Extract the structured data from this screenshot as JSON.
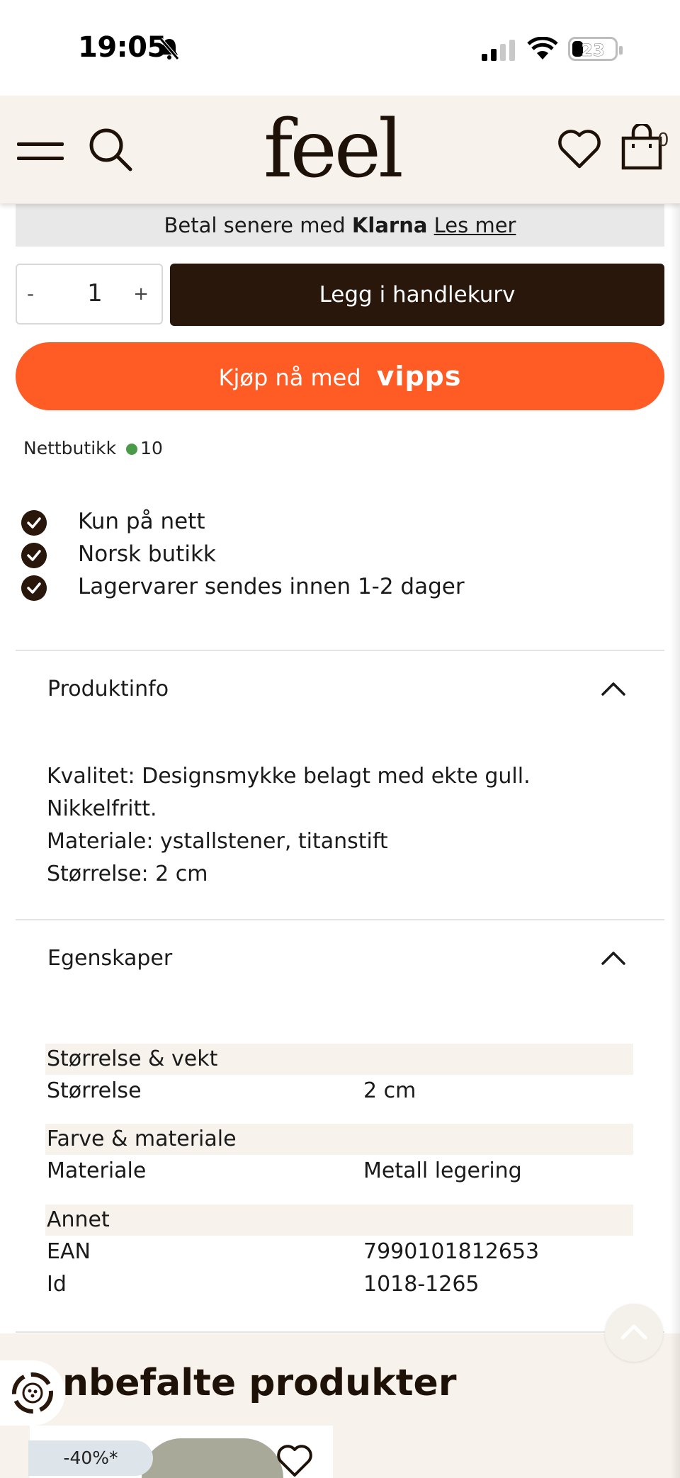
{
  "status_bar": {
    "time": "19:05",
    "battery": "23"
  },
  "header": {
    "logo": "feel",
    "cart_count": "0"
  },
  "klarna": {
    "prefix": "Betal senere med",
    "brand": "Klarna",
    "link": "Les mer"
  },
  "purchase": {
    "qty_minus": "-",
    "qty_value": "1",
    "qty_plus": "+",
    "add_to_cart": "Legg i handlekurv",
    "vipps_prefix": "Kjøp nå med",
    "vipps_brand": "vipps"
  },
  "stock": {
    "label": "Nettbutikk",
    "count": "10",
    "status_color": "#4a9a4a"
  },
  "usps": [
    "Kun på nett",
    "Norsk butikk",
    "Lagervarer sendes innen 1-2 dager"
  ],
  "product_info": {
    "title": "Produktinfo",
    "lines": [
      "Kvalitet: Designsmykke belagt med ekte gull.",
      "Nikkelfritt.",
      "Materiale: ystallstener, titanstift",
      "Størrelse: 2 cm"
    ]
  },
  "properties": {
    "title": "Egenskaper",
    "groups": [
      {
        "name": "Størrelse & vekt",
        "rows": [
          {
            "label": "Størrelse",
            "value": "2 cm"
          }
        ]
      },
      {
        "name": "Farve & materiale",
        "rows": [
          {
            "label": "Materiale",
            "value": "Metall legering"
          }
        ]
      },
      {
        "name": "Annet",
        "rows": [
          {
            "label": "EAN",
            "value": "7990101812653"
          },
          {
            "label": "Id",
            "value": "1018-1265"
          }
        ]
      }
    ]
  },
  "recommended": {
    "title": "nbefalte produkter",
    "badge": "-40%*"
  },
  "colors": {
    "brand_dark": "#2a170c",
    "vipps": "#ff5b24",
    "cream": "#f7f3ec"
  }
}
